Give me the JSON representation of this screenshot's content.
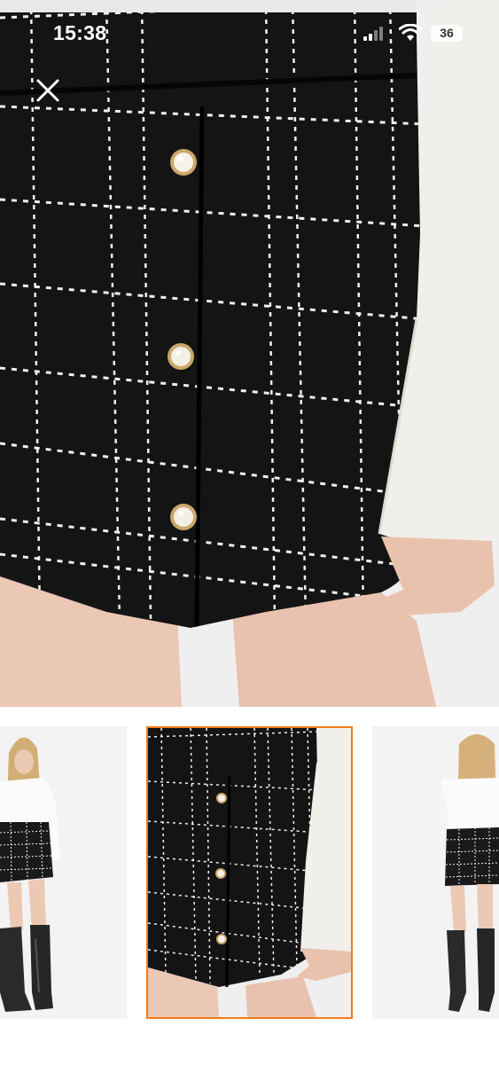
{
  "status_bar": {
    "time": "15:38",
    "battery": "36",
    "signal_icon": "cellular-signal-icon",
    "wifi_icon": "wifi-icon"
  },
  "close_button": {
    "icon": "close-icon"
  },
  "gallery": {
    "selected_index": 1,
    "accent_color": "#f27a1a",
    "thumbnails": [
      {
        "icon": "product-thumbnail"
      },
      {
        "icon": "product-thumbnail"
      },
      {
        "icon": "product-thumbnail"
      }
    ]
  },
  "colors": {
    "skirt": "#141414",
    "tweed_thread": "#f0f0f0",
    "sweater": "#f1efea",
    "background": "#ffffff",
    "selected_border": "#f27a1a"
  }
}
